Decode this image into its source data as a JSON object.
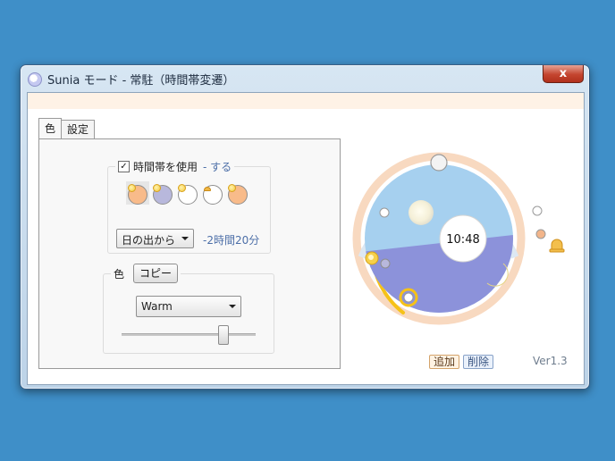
{
  "window": {
    "title": "Sunia モード - 常駐（時間帯変遷）",
    "close_symbol": "x"
  },
  "tabs": [
    {
      "label": "色",
      "active": true
    },
    {
      "label": "設定",
      "active": false
    }
  ],
  "timezone_group": {
    "checkbox_checked": true,
    "checkbox_mark": "✓",
    "label": "時間帯を使用",
    "status": "- する",
    "phase_icons": [
      {
        "name": "sunrise-orange-icon",
        "fill": "#f8bb8a",
        "badge": "sun"
      },
      {
        "name": "sun-lavender-icon",
        "fill": "#b8b8dc",
        "badge": "sun"
      },
      {
        "name": "sun-white-icon",
        "fill": "#ffffff",
        "badge": "sun"
      },
      {
        "name": "bell-white-icon",
        "fill": "#ffffff",
        "badge": "bell"
      },
      {
        "name": "sunset-orange-icon",
        "fill": "#f8bb8a",
        "badge": "sun"
      }
    ],
    "base_select": "日の出から",
    "offset": "-2時間20分"
  },
  "color_group": {
    "label": "色",
    "copy_label": "コピー",
    "preset_select": "Warm",
    "slider_value": 0.75
  },
  "dial": {
    "time": "10:48",
    "day_sky_color": "#a6d0ef",
    "night_sky_color": "#8c92da",
    "ring_color": "#f8d9c0",
    "highlight_arc_color": "#f6c218"
  },
  "buttons": {
    "add": "追加",
    "delete": "削除"
  },
  "version": "Ver1.3"
}
